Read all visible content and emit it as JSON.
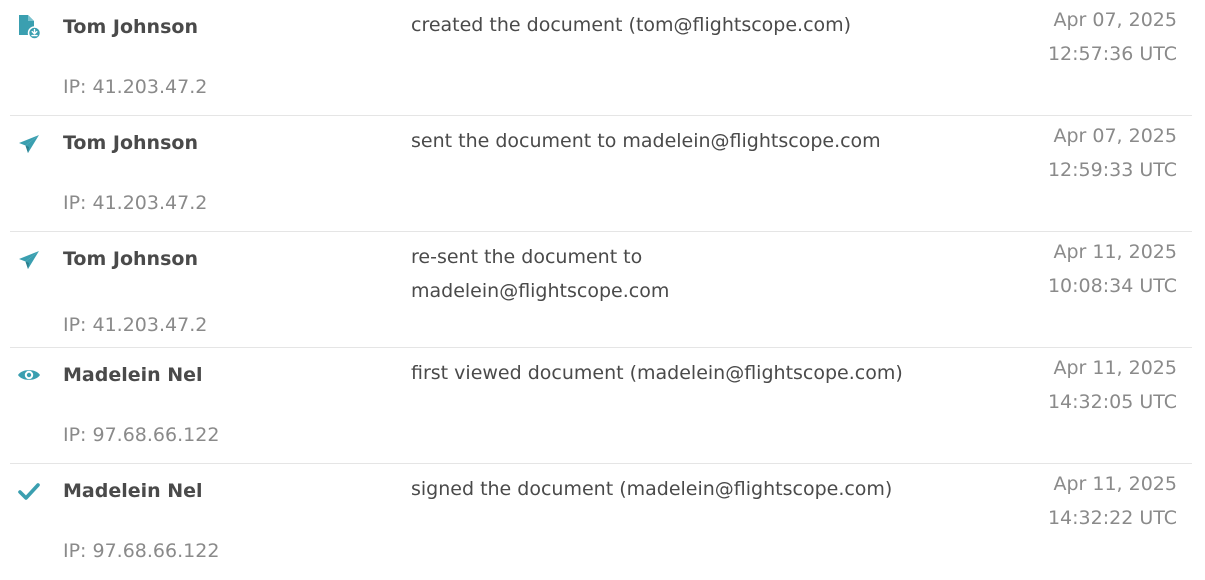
{
  "accent_color": "#3a9fb0",
  "events": [
    {
      "icon": "document-created-icon",
      "actor": "Tom Johnson",
      "action": "created the document (tom@flightscope.com)",
      "ip": "IP: 41.203.47.2",
      "date": "Apr 07, 2025",
      "time": "12:57:36 UTC"
    },
    {
      "icon": "paper-plane-icon",
      "actor": "Tom Johnson",
      "action": "sent the document to madelein@flightscope.com",
      "ip": "IP: 41.203.47.2",
      "date": "Apr 07, 2025",
      "time": "12:59:33 UTC"
    },
    {
      "icon": "paper-plane-icon",
      "actor": "Tom Johnson",
      "action": "re-sent the document to madelein@flightscope.com",
      "ip": "IP: 41.203.47.2",
      "date": "Apr 11, 2025",
      "time": "10:08:34 UTC"
    },
    {
      "icon": "eye-icon",
      "actor": "Madelein Nel",
      "action": "first viewed document (madelein@flightscope.com)",
      "ip": "IP: 97.68.66.122",
      "date": "Apr 11, 2025",
      "time": "14:32:05 UTC"
    },
    {
      "icon": "checkmark-icon",
      "actor": "Madelein Nel",
      "action": "signed the document (madelein@flightscope.com)",
      "ip": "IP: 97.68.66.122",
      "date": "Apr 11, 2025",
      "time": "14:32:22 UTC"
    }
  ]
}
